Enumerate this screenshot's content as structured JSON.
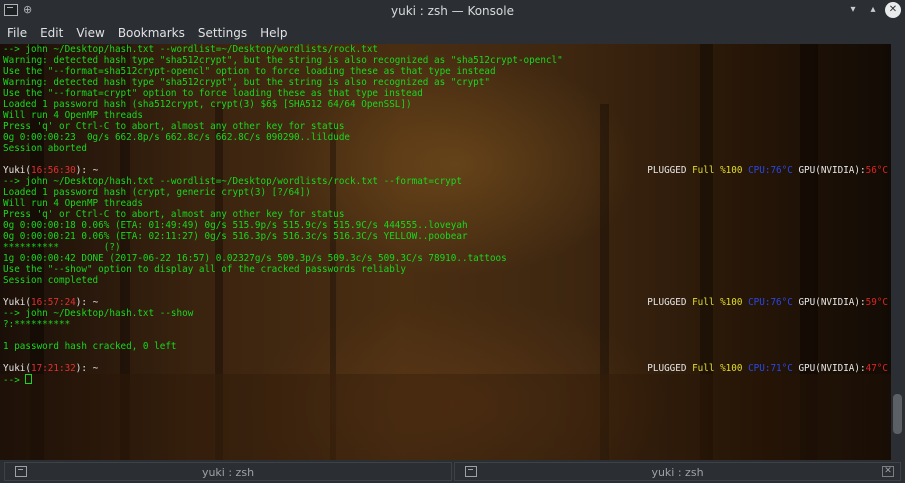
{
  "window": {
    "title": "yuki : zsh — Konsole"
  },
  "menu": [
    "File",
    "Edit",
    "View",
    "Bookmarks",
    "Settings",
    "Help"
  ],
  "terminal": {
    "lines": [
      {
        "kind": "out",
        "text": "--> john ~/Desktop/hash.txt --wordlist=~/Desktop/wordlists/rock.txt"
      },
      {
        "kind": "out",
        "text": "Warning: detected hash type \"sha512crypt\", but the string is also recognized as \"sha512crypt-opencl\""
      },
      {
        "kind": "out",
        "text": "Use the \"--format=sha512crypt-opencl\" option to force loading these as that type instead"
      },
      {
        "kind": "out",
        "text": "Warning: detected hash type \"sha512crypt\", but the string is also recognized as \"crypt\""
      },
      {
        "kind": "out",
        "text": "Use the \"--format=crypt\" option to force loading these as that type instead"
      },
      {
        "kind": "out",
        "text": "Loaded 1 password hash (sha512crypt, crypt(3) $6$ [SHA512 64/64 OpenSSL])"
      },
      {
        "kind": "out",
        "text": "Will run 4 OpenMP threads"
      },
      {
        "kind": "out",
        "text": "Press 'q' or Ctrl-C to abort, almost any other key for status"
      },
      {
        "kind": "out",
        "text": "0g 0:00:00:23  0g/s 662.8p/s 662.8c/s 662.8C/s 090290..lildude"
      },
      {
        "kind": "out",
        "text": "Session aborted"
      },
      {
        "kind": "blank",
        "text": ""
      },
      {
        "kind": "prompt",
        "host": "Yuki(",
        "time": "16:56:30",
        "rest": "): ~",
        "status": {
          "plugged": "PLUGGED ",
          "full": "Full %100 ",
          "cpu": "CPU:76°C ",
          "gpu": "GPU(NVIDIA):",
          "gpu_temp": "56°C"
        }
      },
      {
        "kind": "out",
        "text": "--> john ~/Desktop/hash.txt --wordlist=~/Desktop/wordlists/rock.txt --format=crypt"
      },
      {
        "kind": "out",
        "text": "Loaded 1 password hash (crypt, generic crypt(3) [?/64])"
      },
      {
        "kind": "out",
        "text": "Will run 4 OpenMP threads"
      },
      {
        "kind": "out",
        "text": "Press 'q' or Ctrl-C to abort, almost any other key for status"
      },
      {
        "kind": "out",
        "text": "0g 0:00:00:18 0.06% (ETA: 01:49:49) 0g/s 515.9p/s 515.9c/s 515.9C/s 444555..loveyah"
      },
      {
        "kind": "out",
        "text": "0g 0:00:00:21 0.06% (ETA: 02:11:27) 0g/s 516.3p/s 516.3c/s 516.3C/s YELLOW..poobear"
      },
      {
        "kind": "out",
        "text": "**********        (?)"
      },
      {
        "kind": "out",
        "text": "1g 0:00:00:42 DONE (2017-06-22 16:57) 0.02327g/s 509.3p/s 509.3c/s 509.3C/s 78910..tattoos"
      },
      {
        "kind": "out",
        "text": "Use the \"--show\" option to display all of the cracked passwords reliably"
      },
      {
        "kind": "out",
        "text": "Session completed"
      },
      {
        "kind": "blank",
        "text": ""
      },
      {
        "kind": "prompt",
        "host": "Yuki(",
        "time": "16:57:24",
        "rest": "): ~",
        "status": {
          "plugged": "PLUGGED ",
          "full": "Full %100 ",
          "cpu": "CPU:76°C ",
          "gpu": "GPU(NVIDIA):",
          "gpu_temp": "59°C"
        }
      },
      {
        "kind": "out",
        "text": "--> john ~/Desktop/hash.txt --show"
      },
      {
        "kind": "out",
        "text": "?:**********"
      },
      {
        "kind": "blank",
        "text": ""
      },
      {
        "kind": "out",
        "text": "1 password hash cracked, 0 left"
      },
      {
        "kind": "blank",
        "text": ""
      },
      {
        "kind": "prompt",
        "host": "Yuki(",
        "time": "17:21:32",
        "rest": "): ~",
        "status": {
          "plugged": "PLUGGED ",
          "full": "Full %100 ",
          "cpu": "CPU:71°C ",
          "gpu": "GPU(NVIDIA):",
          "gpu_temp": "47°C"
        }
      },
      {
        "kind": "cursor",
        "text": "--> "
      }
    ]
  },
  "tabs": [
    {
      "label": "yuki : zsh"
    },
    {
      "label": "yuki : zsh"
    }
  ],
  "colors": {
    "output_green": "#19d81f",
    "clock_red": "#e23030",
    "full_yellow": "#e2de2a",
    "cpu_blue": "#2a48e8",
    "gpu_temp_red": "#e02424"
  }
}
